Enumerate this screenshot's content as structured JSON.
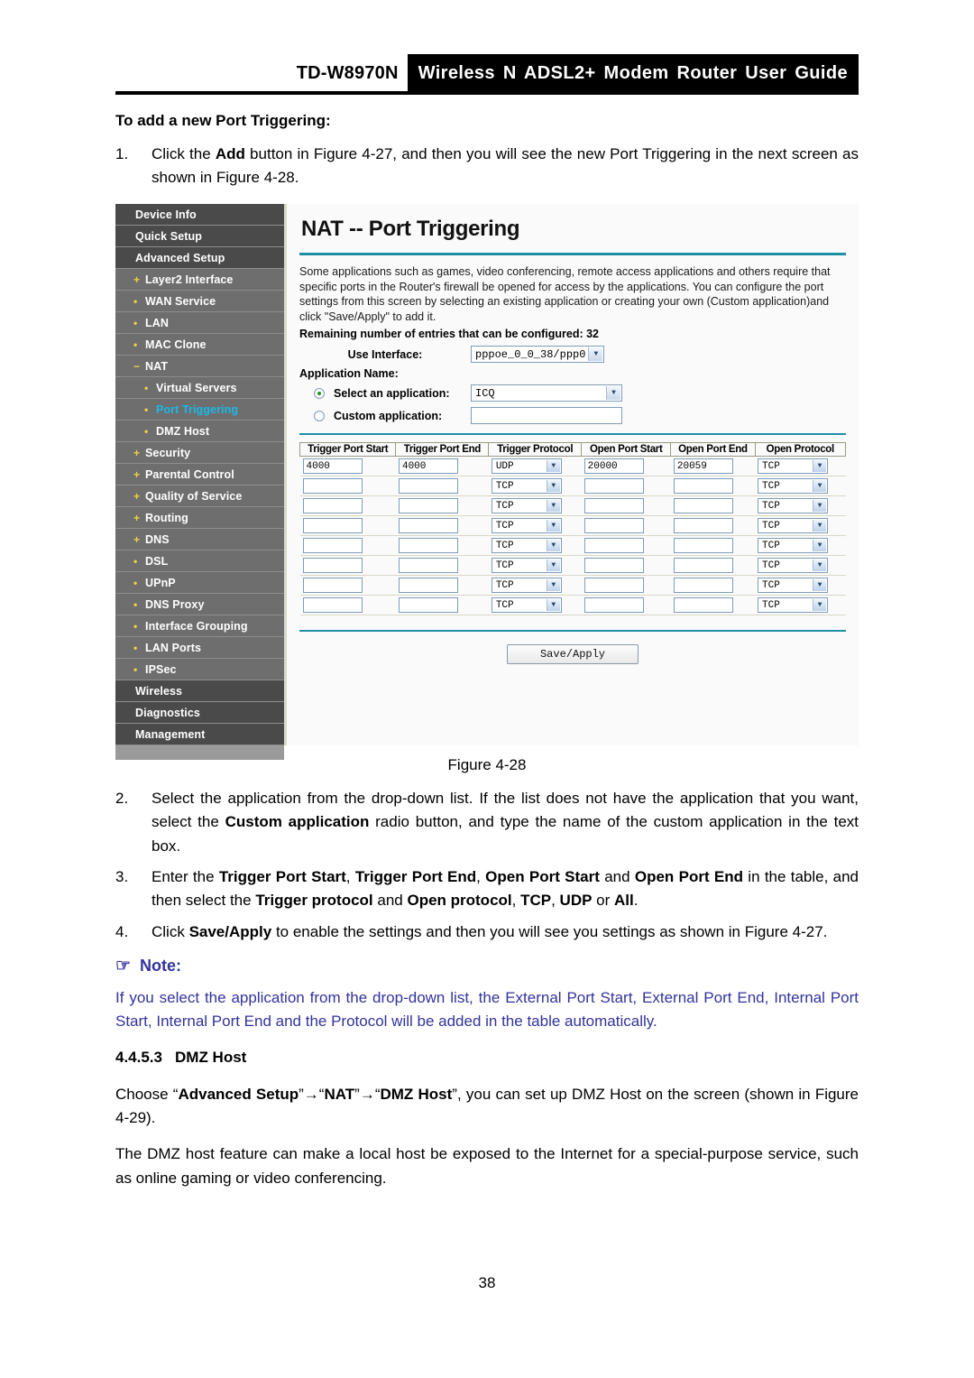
{
  "header": {
    "model": "TD-W8970N",
    "title": "Wireless N ADSL2+ Modem Router User Guide"
  },
  "body": {
    "heading": "To add a new Port Triggering:",
    "step1_num": "1.",
    "step1_text_a": "Click the ",
    "step1_bold_a": "Add",
    "step1_text_b": " button in Figure 4-27, and then you will see the new Port Triggering in the next screen as shown in Figure 4-28.",
    "step2_num": "2.",
    "step2_text_a": "Select the application from the drop-down list. If the list does not have the application that you want, select the ",
    "step2_bold_a": "Custom application",
    "step2_text_b": " radio button, and type the name of the custom application in the text box.",
    "step3_num": "3.",
    "step3_text_a": "Enter the ",
    "step3_bold_a": "Trigger Port Start",
    "step3_text_b": ", ",
    "step3_bold_b": "Trigger Port End",
    "step3_text_c": ", ",
    "step3_bold_c": "Open Port Start",
    "step3_text_d": " and ",
    "step3_bold_d": "Open Port End",
    "step3_text_e": " in the table, and then select the ",
    "step3_bold_e": "Trigger protocol",
    "step3_text_f": " and ",
    "step3_bold_f": "Open protocol",
    "step3_text_g": ", ",
    "step3_bold_g": "TCP",
    "step3_text_h": ", ",
    "step3_bold_h": "UDP",
    "step3_text_i": " or ",
    "step3_bold_i": "All",
    "step3_text_j": ".",
    "step4_num": "4.",
    "step4_text_a": "Click ",
    "step4_bold_a": "Save/Apply",
    "step4_text_b": " to enable the settings and then you will see you settings as shown in Figure 4-27."
  },
  "note": {
    "icon": "pointing-hand-icon",
    "icon_glyph": "☞",
    "label": "Note:",
    "text": "If you select the application from the drop-down list, the External Port Start, External Port End, Internal Port Start, Internal Port End and the Protocol will be added in the table automatically.",
    "color": "#33339c"
  },
  "dmz_section": {
    "number": "4.4.5.3",
    "title": "DMZ Host",
    "para1_a": "Choose “",
    "para1_b1": "Advanced Setup",
    "para1_c": "”→“",
    "para1_b2": "NAT",
    "para1_d": "”→“",
    "para1_b3": "DMZ Host",
    "para1_e": "”, you can set up DMZ Host on the screen (shown in Figure 4-29).",
    "para2": "The DMZ host feature can make a local host be exposed to the Internet for a special-purpose service, such as online gaming or video conferencing."
  },
  "figure": {
    "caption": "Figure 4-28",
    "sidebar": {
      "items": [
        {
          "label": "Device Info",
          "level": 0,
          "bullet": "",
          "active": false,
          "style": "dark"
        },
        {
          "label": "Quick Setup",
          "level": 0,
          "bullet": "",
          "active": false,
          "style": "dark"
        },
        {
          "label": "Advanced Setup",
          "level": 0,
          "bullet": "",
          "active": false,
          "style": "dark"
        },
        {
          "label": "Layer2 Interface",
          "level": 1,
          "bullet": "+",
          "active": false,
          "style": "mid"
        },
        {
          "label": "WAN Service",
          "level": 1,
          "bullet": "•",
          "active": false,
          "style": "mid"
        },
        {
          "label": "LAN",
          "level": 1,
          "bullet": "•",
          "active": false,
          "style": "mid"
        },
        {
          "label": "MAC Clone",
          "level": 1,
          "bullet": "•",
          "active": false,
          "style": "mid"
        },
        {
          "label": "NAT",
          "level": 1,
          "bullet": "−",
          "active": false,
          "style": "mid"
        },
        {
          "label": "Virtual Servers",
          "level": 2,
          "bullet": "•",
          "active": false,
          "style": "mid"
        },
        {
          "label": "Port Triggering",
          "level": 2,
          "bullet": "•",
          "active": true,
          "style": "mid"
        },
        {
          "label": "DMZ Host",
          "level": 2,
          "bullet": "•",
          "active": false,
          "style": "mid"
        },
        {
          "label": "Security",
          "level": 1,
          "bullet": "+",
          "active": false,
          "style": "mid"
        },
        {
          "label": "Parental Control",
          "level": 1,
          "bullet": "+",
          "active": false,
          "style": "mid"
        },
        {
          "label": "Quality of Service",
          "level": 1,
          "bullet": "+",
          "active": false,
          "style": "mid"
        },
        {
          "label": "Routing",
          "level": 1,
          "bullet": "+",
          "active": false,
          "style": "mid"
        },
        {
          "label": "DNS",
          "level": 1,
          "bullet": "+",
          "active": false,
          "style": "mid"
        },
        {
          "label": "DSL",
          "level": 1,
          "bullet": "•",
          "active": false,
          "style": "mid"
        },
        {
          "label": "UPnP",
          "level": 1,
          "bullet": "•",
          "active": false,
          "style": "mid"
        },
        {
          "label": "DNS Proxy",
          "level": 1,
          "bullet": "•",
          "active": false,
          "style": "mid"
        },
        {
          "label": "Interface Grouping",
          "level": 1,
          "bullet": "•",
          "active": false,
          "style": "mid"
        },
        {
          "label": "LAN Ports",
          "level": 1,
          "bullet": "•",
          "active": false,
          "style": "mid"
        },
        {
          "label": "IPSec",
          "level": 1,
          "bullet": "•",
          "active": false,
          "style": "mid"
        },
        {
          "label": "Wireless",
          "level": 0,
          "bullet": "",
          "active": false,
          "style": "dark"
        },
        {
          "label": "Diagnostics",
          "level": 0,
          "bullet": "",
          "active": false,
          "style": "dark"
        },
        {
          "label": "Management",
          "level": 0,
          "bullet": "",
          "active": false,
          "style": "dark"
        }
      ],
      "active_color": "#1bb8e8",
      "bullet_color": "#f0d040"
    },
    "panel": {
      "title": "NAT -- Port Triggering",
      "description": "Some applications such as games, video conferencing, remote access applications and others require that specific ports in the Router's firewall be opened for access by the applications. You can configure the port settings from this screen by selecting an existing application or creating your own (Custom application)and click \"Save/Apply\" to add it.",
      "remaining": "Remaining number of entries that can be configured: 32",
      "use_interface_label": "Use Interface:",
      "use_interface_value": "pppoe_0_0_38/ppp0",
      "application_name_label": "Application Name:",
      "select_app_label": "Select an application:",
      "select_app_value": "ICQ",
      "select_app_selected": true,
      "custom_app_label": "Custom application:",
      "custom_app_value": "",
      "custom_app_selected": false,
      "save_button": "Save/Apply",
      "table": {
        "headers": [
          "Trigger Port Start",
          "Trigger Port End",
          "Trigger Protocol",
          "Open Port Start",
          "Open Port End",
          "Open Protocol"
        ],
        "rows": [
          {
            "trigger_port_start": "4000",
            "trigger_port_end": "4000",
            "trigger_protocol": "UDP",
            "open_port_start": "20000",
            "open_port_end": "20059",
            "open_protocol": "TCP"
          },
          {
            "trigger_port_start": "",
            "trigger_port_end": "",
            "trigger_protocol": "TCP",
            "open_port_start": "",
            "open_port_end": "",
            "open_protocol": "TCP"
          },
          {
            "trigger_port_start": "",
            "trigger_port_end": "",
            "trigger_protocol": "TCP",
            "open_port_start": "",
            "open_port_end": "",
            "open_protocol": "TCP"
          },
          {
            "trigger_port_start": "",
            "trigger_port_end": "",
            "trigger_protocol": "TCP",
            "open_port_start": "",
            "open_port_end": "",
            "open_protocol": "TCP"
          },
          {
            "trigger_port_start": "",
            "trigger_port_end": "",
            "trigger_protocol": "TCP",
            "open_port_start": "",
            "open_port_end": "",
            "open_protocol": "TCP"
          },
          {
            "trigger_port_start": "",
            "trigger_port_end": "",
            "trigger_protocol": "TCP",
            "open_port_start": "",
            "open_port_end": "",
            "open_protocol": "TCP"
          },
          {
            "trigger_port_start": "",
            "trigger_port_end": "",
            "trigger_protocol": "TCP",
            "open_port_start": "",
            "open_port_end": "",
            "open_protocol": "TCP"
          },
          {
            "trigger_port_start": "",
            "trigger_port_end": "",
            "trigger_protocol": "TCP",
            "open_port_start": "",
            "open_port_end": "",
            "open_protocol": "TCP"
          }
        ]
      }
    }
  },
  "page_number": "38"
}
